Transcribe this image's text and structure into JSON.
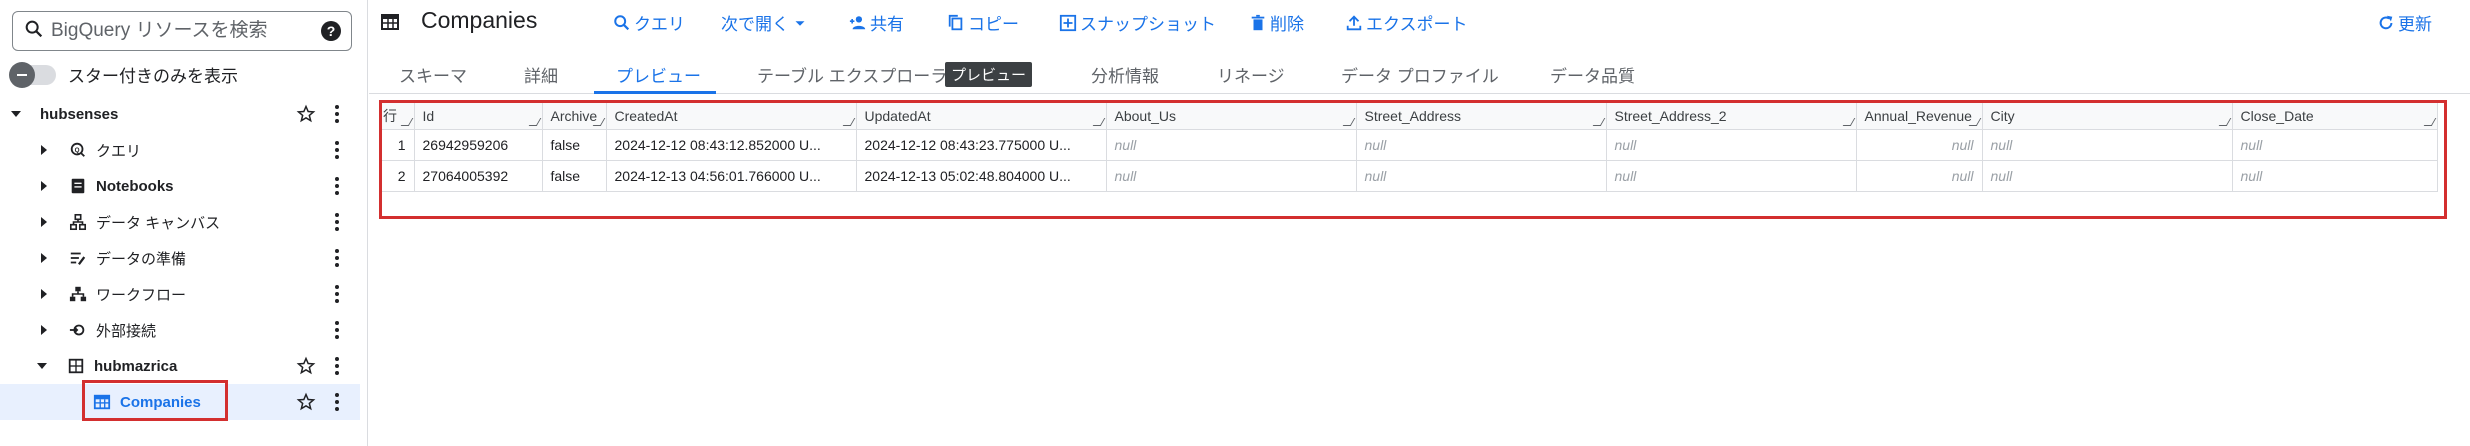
{
  "sidebar": {
    "search_placeholder": "BigQuery リソースを検索",
    "star_toggle_label": "スター付きのみを表示",
    "project": "hubsenses",
    "items": [
      {
        "label": "クエリ"
      },
      {
        "label": "Notebooks"
      },
      {
        "label": "データ キャンバス"
      },
      {
        "label": "データの準備"
      },
      {
        "label": "ワークフロー"
      },
      {
        "label": "外部接続"
      }
    ],
    "dataset": "hubmazrica",
    "table": "Companies"
  },
  "header": {
    "title": "Companies",
    "buttons": {
      "query": "クエリ",
      "open_with": "次で開く",
      "share": "共有",
      "copy": "コピー",
      "snapshot": "スナップショット",
      "delete": "削除",
      "export": "エクスポート",
      "refresh": "更新"
    }
  },
  "tabs": {
    "schema": "スキーマ",
    "details": "詳細",
    "preview": "プレビュー",
    "table_explorer": "テーブル エクスプローラ",
    "table_explorer_badge": "プレビュー",
    "insights": "分析情報",
    "lineage": "リネージ",
    "data_profile": "データ プロファイル",
    "data_quality": "データ品質"
  },
  "table": {
    "columns": [
      "行",
      "Id",
      "Archive",
      "CreatedAt",
      "UpdatedAt",
      "About_Us",
      "Street_Address",
      "Street_Address_2",
      "Annual_Revenue",
      "City",
      "Close_Date"
    ],
    "rows": [
      [
        "1",
        "26942959206",
        "false",
        "2024-12-12 08:43:12.852000 U...",
        "2024-12-12 08:43:23.775000 U...",
        "null",
        "null",
        "null",
        "null",
        "null",
        "null"
      ],
      [
        "2",
        "27064005392",
        "false",
        "2024-12-13 04:56:01.766000 U...",
        "2024-12-13 05:02:48.804000 U...",
        "null",
        "null",
        "null",
        "null",
        "null",
        "null"
      ]
    ]
  },
  "colors": {
    "accent": "#1a73e8",
    "highlight": "#d32f2f"
  }
}
